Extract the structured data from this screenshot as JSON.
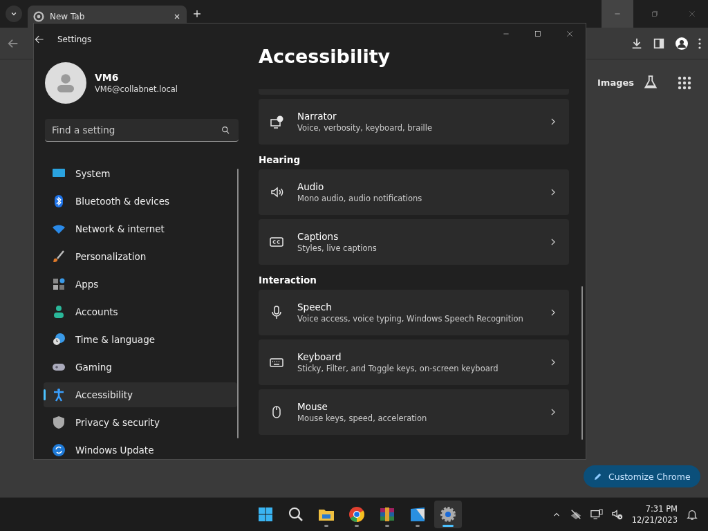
{
  "browser": {
    "tab": {
      "title": "New Tab",
      "selected": true
    },
    "links": [
      "Images"
    ],
    "customize_button": "Customize Chrome"
  },
  "settings": {
    "window": {
      "title": "Settings"
    },
    "user": {
      "name": "VM6",
      "email": "VM6@collabnet.local"
    },
    "search": {
      "placeholder": "Find a setting"
    },
    "nav": [
      {
        "label": "System",
        "selected": false
      },
      {
        "label": "Bluetooth & devices",
        "selected": false
      },
      {
        "label": "Network & internet",
        "selected": false
      },
      {
        "label": "Personalization",
        "selected": false
      },
      {
        "label": "Apps",
        "selected": false
      },
      {
        "label": "Accounts",
        "selected": false
      },
      {
        "label": "Time & language",
        "selected": false
      },
      {
        "label": "Gaming",
        "selected": false
      },
      {
        "label": "Accessibility",
        "selected": true
      },
      {
        "label": "Privacy & security",
        "selected": false
      },
      {
        "label": "Windows Update",
        "selected": false
      }
    ],
    "page_title": "Accessibility",
    "sections": [
      {
        "items": [
          {
            "title": "Narrator",
            "description": "Voice, verbosity, keyboard, braille"
          }
        ]
      },
      {
        "header": "Hearing",
        "items": [
          {
            "title": "Audio",
            "description": "Mono audio, audio notifications"
          },
          {
            "title": "Captions",
            "description": "Styles, live captions"
          }
        ]
      },
      {
        "header": "Interaction",
        "items": [
          {
            "title": "Speech",
            "description": "Voice access, voice typing, Windows Speech Recognition"
          },
          {
            "title": "Keyboard",
            "description": "Sticky, Filter, and Toggle keys, on-screen keyboard"
          },
          {
            "title": "Mouse",
            "description": "Mouse keys, speed, acceleration"
          }
        ]
      }
    ]
  },
  "taskbar": {
    "apps": [
      {
        "running": false,
        "selected": false
      },
      {
        "running": false,
        "selected": false
      },
      {
        "running": true,
        "selected": false
      },
      {
        "running": true,
        "selected": false
      },
      {
        "running": true,
        "selected": false
      },
      {
        "running": true,
        "selected": false
      },
      {
        "running": true,
        "selected": true
      }
    ],
    "time": "7:31 PM",
    "date": "12/21/2023"
  }
}
